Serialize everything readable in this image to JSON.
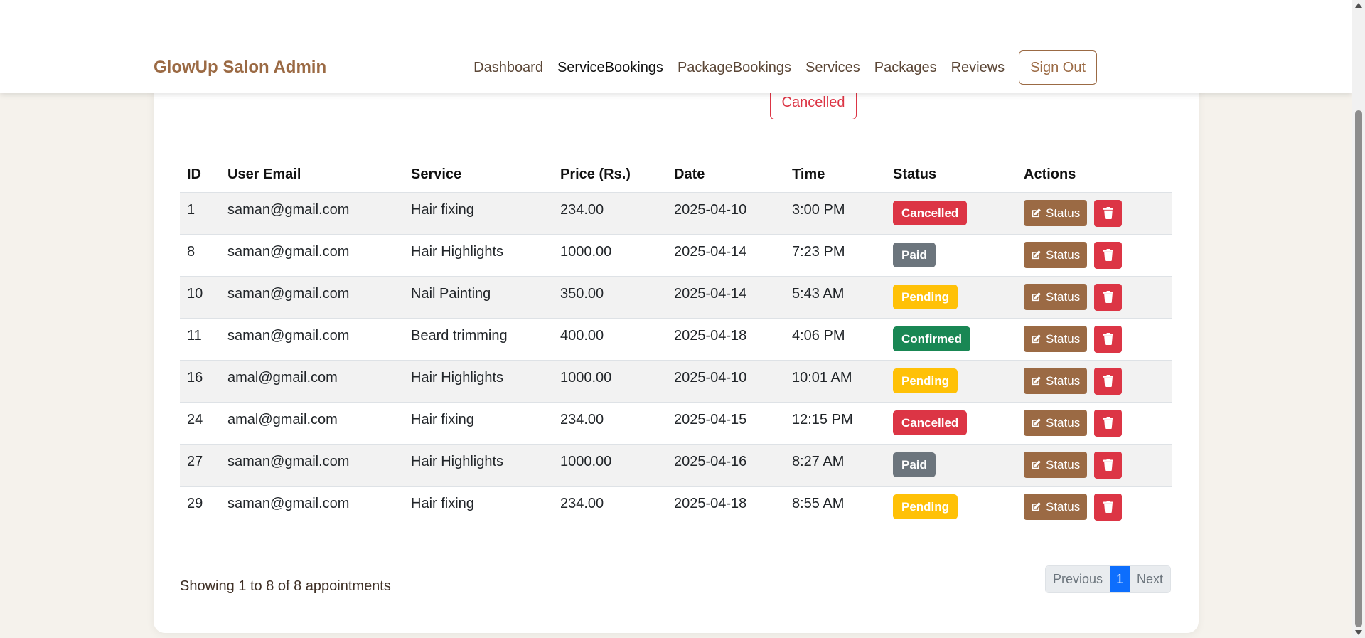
{
  "navbar": {
    "brand": "GlowUp Salon Admin",
    "links": [
      {
        "label": "Dashboard"
      },
      {
        "label": "ServiceBookings"
      },
      {
        "label": "PackageBookings"
      },
      {
        "label": "Services"
      },
      {
        "label": "Packages"
      },
      {
        "label": "Reviews"
      }
    ],
    "active_link": "ServiceBookings",
    "sign_out": "Sign Out"
  },
  "filter": {
    "cancelled_label": "Cancelled"
  },
  "table": {
    "headers": {
      "id": "ID",
      "email": "User Email",
      "service": "Service",
      "price": "Price (Rs.)",
      "date": "Date",
      "time": "Time",
      "status": "Status",
      "actions": "Actions"
    },
    "status_button_label": "Status",
    "rows": [
      {
        "id": "1",
        "email": "saman@gmail.com",
        "service": "Hair fixing",
        "price": "234.00",
        "date": "2025-04-10",
        "time": "3:00 PM",
        "status": "Cancelled"
      },
      {
        "id": "8",
        "email": "saman@gmail.com",
        "service": "Hair Highlights",
        "price": "1000.00",
        "date": "2025-04-14",
        "time": "7:23 PM",
        "status": "Paid"
      },
      {
        "id": "10",
        "email": "saman@gmail.com",
        "service": "Nail Painting",
        "price": "350.00",
        "date": "2025-04-14",
        "time": "5:43 AM",
        "status": "Pending"
      },
      {
        "id": "11",
        "email": "saman@gmail.com",
        "service": "Beard trimming",
        "price": "400.00",
        "date": "2025-04-18",
        "time": "4:06 PM",
        "status": "Confirmed"
      },
      {
        "id": "16",
        "email": "amal@gmail.com",
        "service": "Hair Highlights",
        "price": "1000.00",
        "date": "2025-04-10",
        "time": "10:01 AM",
        "status": "Pending"
      },
      {
        "id": "24",
        "email": "amal@gmail.com",
        "service": "Hair fixing",
        "price": "234.00",
        "date": "2025-04-15",
        "time": "12:15 PM",
        "status": "Cancelled"
      },
      {
        "id": "27",
        "email": "saman@gmail.com",
        "service": "Hair Highlights",
        "price": "1000.00",
        "date": "2025-04-16",
        "time": "8:27 AM",
        "status": "Paid"
      },
      {
        "id": "29",
        "email": "saman@gmail.com",
        "service": "Hair fixing",
        "price": "234.00",
        "date": "2025-04-18",
        "time": "8:55 AM",
        "status": "Pending"
      }
    ]
  },
  "footer": {
    "showing_text": "Showing 1 to 8 of 8 appointments",
    "pagination": {
      "previous": "Previous",
      "current_page": "1",
      "next": "Next"
    }
  },
  "colors": {
    "brand": "#9b6a44",
    "cancelled": "#dc3545",
    "paid": "#6c757d",
    "pending": "#ffc107",
    "confirmed": "#198754",
    "page_active": "#0d6efd",
    "background": "#f5f2ec"
  },
  "icons": {
    "status_button_icon": "edit-icon",
    "delete_button_icon": "trash-icon"
  }
}
